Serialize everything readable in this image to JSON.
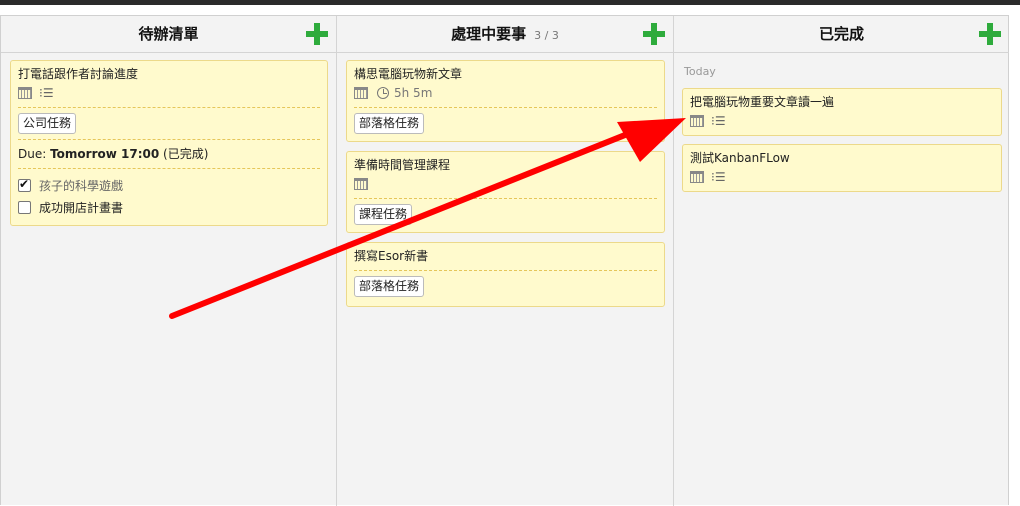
{
  "columns": [
    {
      "title": "待辦清單",
      "count": "",
      "cards": [
        {
          "title": "打電話跟作者討論進度",
          "tag": "公司任務",
          "due_prefix": "Due: ",
          "due_strong": "Tomorrow 17:00",
          "due_suffix": " (已完成)",
          "checklist": [
            {
              "label": "孩子的科學遊戲",
              "checked": true
            },
            {
              "label": "成功開店計畫書",
              "checked": false
            }
          ]
        }
      ]
    },
    {
      "title": "處理中要事",
      "count": "3 / 3",
      "cards": [
        {
          "title": "構思電腦玩物新文章",
          "time": "5h 5m",
          "tag": "部落格任務"
        },
        {
          "title": "準備時間管理課程",
          "tag": "課程任務"
        },
        {
          "title": "撰寫Esor新書",
          "tag": "部落格任務"
        }
      ]
    },
    {
      "title": "已完成",
      "count": "",
      "section": "Today",
      "cards": [
        {
          "title": "把電腦玩物重要文章讀一遍"
        },
        {
          "title": "測試KanbanFLow"
        }
      ]
    }
  ],
  "icons": {
    "add": "plus-icon",
    "date": "calendar-icon",
    "subtasks": "checklist-icon",
    "time": "clock-icon"
  },
  "colors": {
    "card_bg": "#fffacd",
    "add_icon": "#2eab3c",
    "arrow": "#ff0000"
  }
}
